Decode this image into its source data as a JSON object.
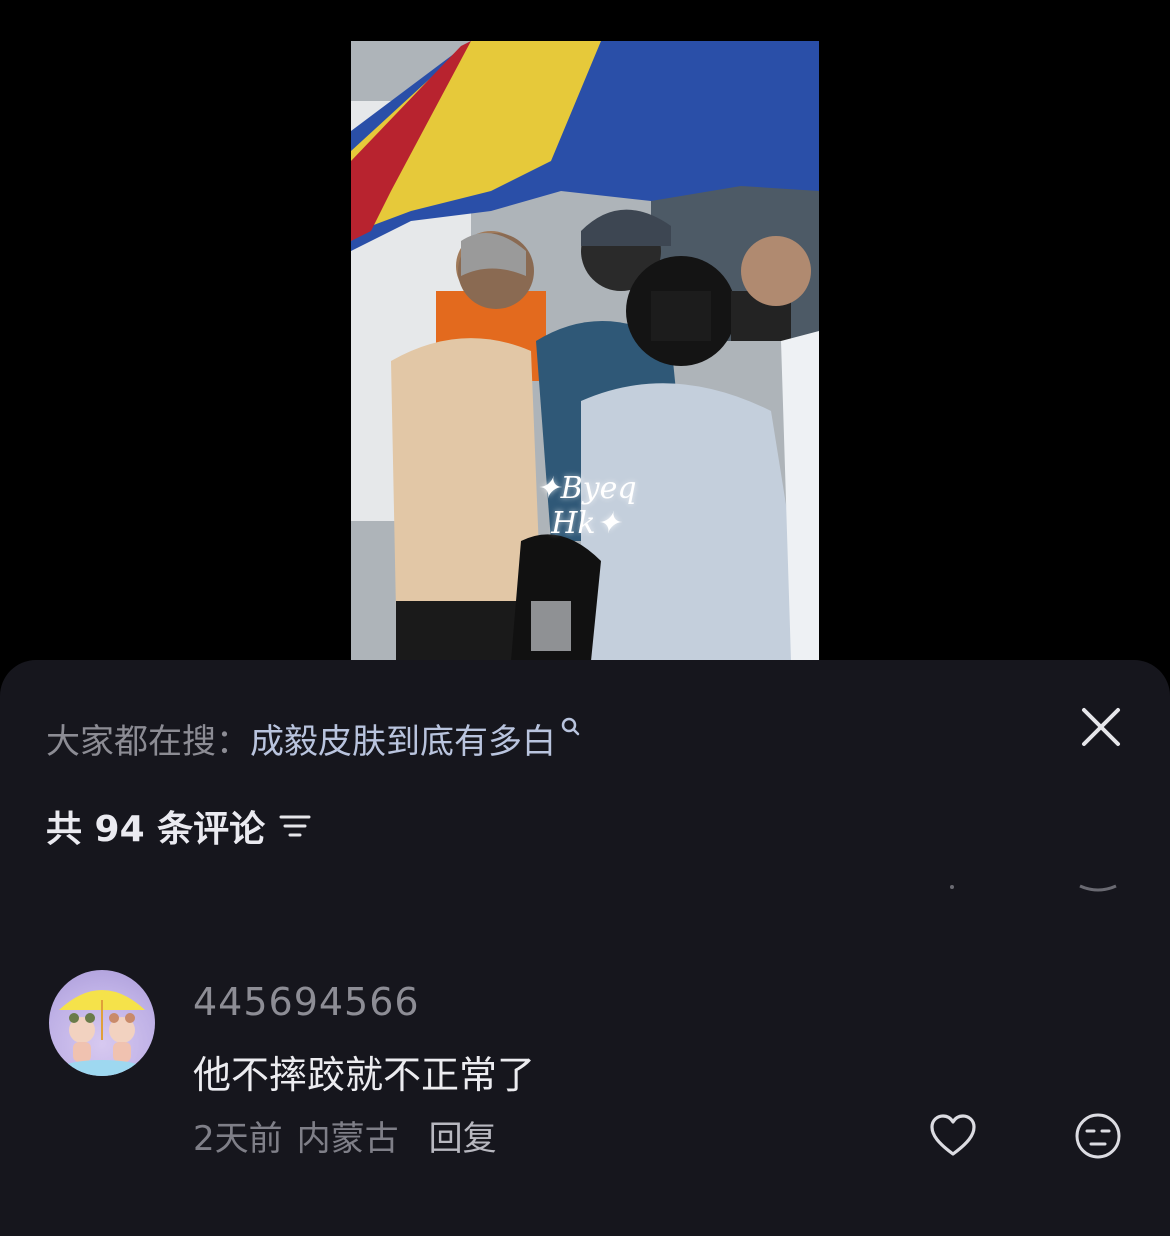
{
  "video": {
    "watermark": "✦Byeq Hk✦"
  },
  "search": {
    "prefix": "大家都在搜：",
    "term": "成毅皮肤到底有多白",
    "icon": "search-icon"
  },
  "comments_header": {
    "count_label": "共 94 条评论",
    "sort_icon": "filter-lines-icon",
    "close_icon": "close-icon"
  },
  "comment": {
    "username": "445694566",
    "text": "他不摔跤就不正常了",
    "time": "2天前",
    "location": "内蒙古",
    "reply_label": "回复",
    "like_icon": "heart-icon",
    "emoji_icon": "emoji-face-icon"
  },
  "colors": {
    "sheet_bg": "#16161d",
    "search_term": "#b9c4de",
    "muted_text": "#8d8d95",
    "primary_text": "#ececf0"
  }
}
